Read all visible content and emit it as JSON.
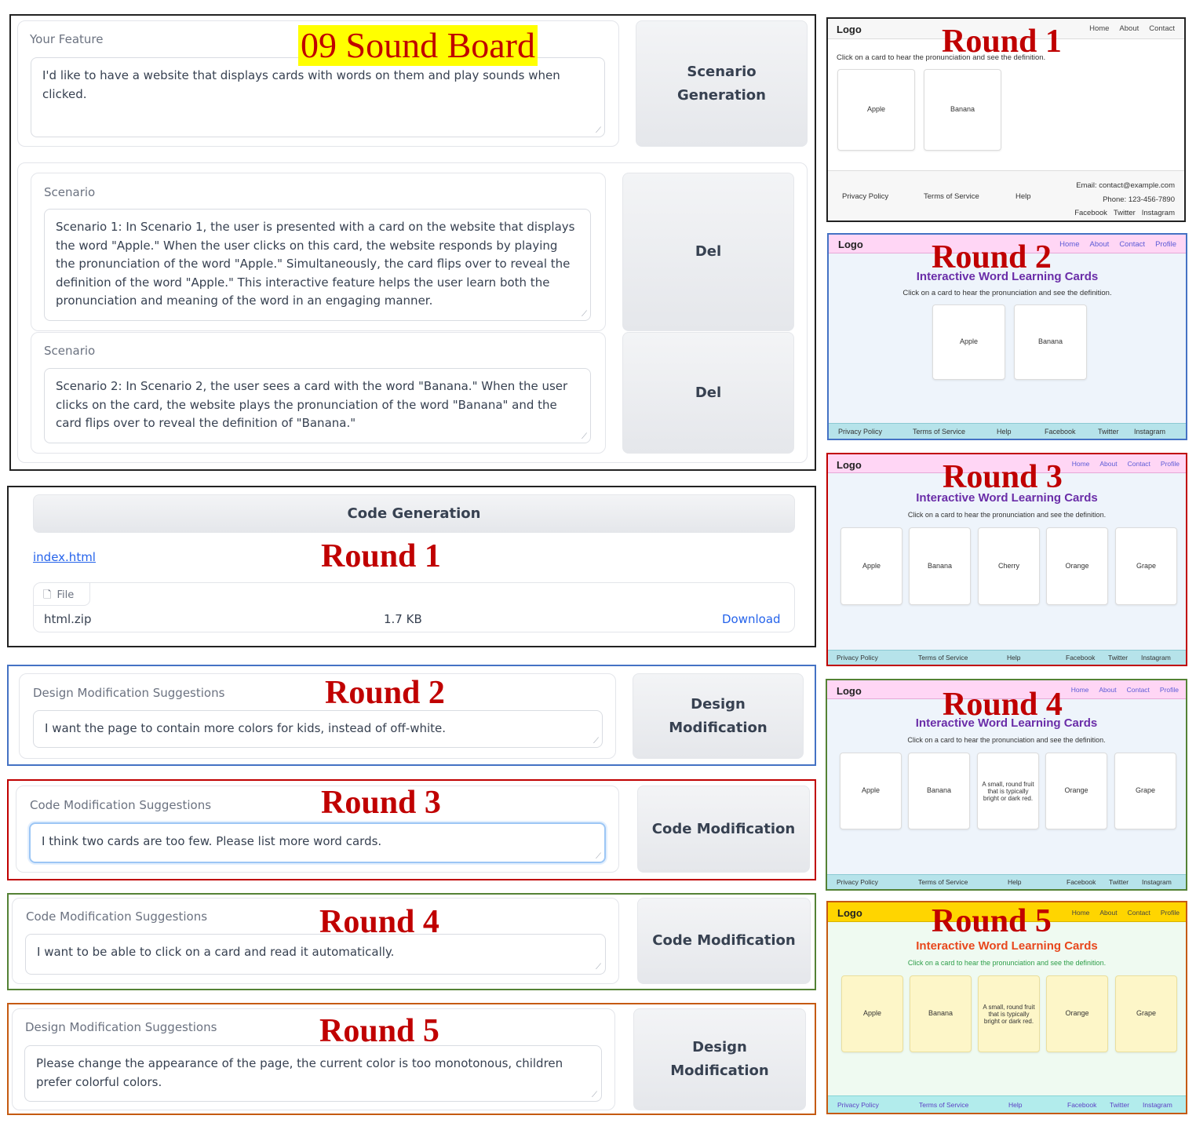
{
  "title": "09 Sound Board",
  "feature": {
    "label": "Your Feature",
    "text": "I'd like to have a website that displays cards with words on them and play sounds when clicked.",
    "button": "Scenario Generation"
  },
  "scenarios": [
    {
      "label": "Scenario",
      "text": "Scenario 1: In Scenario 1, the user is presented with a card on the website that displays the word \"Apple.\" When the user clicks on this card, the website responds by playing the pronunciation of the word \"Apple.\" Simultaneously, the card flips over to reveal the definition of the word \"Apple.\" This interactive feature helps the user learn both the pronunciation and meaning of the word in an engaging manner.",
      "button": "Del"
    },
    {
      "label": "Scenario",
      "text": "Scenario 2: In Scenario 2, the user sees a card with the word \"Banana.\" When the user clicks on the card, the website plays the pronunciation of the word \"Banana\" and the card flips over to reveal the definition of \"Banana.\"",
      "button": "Del"
    }
  ],
  "codegen": {
    "button": "Code Generation",
    "link": "index.html",
    "file_header": "File",
    "file_name": "html.zip",
    "file_size": "1.7 KB",
    "download": "Download"
  },
  "rounds": [
    {
      "label": "Round 1"
    },
    {
      "label": "Round 2",
      "field_label": "Design Modification Suggestions",
      "text": "I want the page to contain more colors for kids, instead of off-white.",
      "button": "Design Modification"
    },
    {
      "label": "Round 3",
      "field_label": "Code Modification Suggestions",
      "text": "I think two cards are too few. Please list more word cards.",
      "button": "Code Modification"
    },
    {
      "label": "Round 4",
      "field_label": "Code Modification Suggestions",
      "text": "I want to be able to click on a card and read it automatically.",
      "button": "Code Modification"
    },
    {
      "label": "Round 5",
      "field_label": "Design Modification Suggestions",
      "text": "Please change the appearance of the page, the current color is too monotonous, children prefer colorful colors.",
      "button": "Design Modification"
    }
  ],
  "previews": {
    "r1": {
      "label": "Round 1",
      "logo": "Logo",
      "nav": [
        "Home",
        "About",
        "Contact"
      ],
      "subtitle": "Click on a card to hear the pronunciation and see the definition.",
      "cards": [
        "Apple",
        "Banana"
      ],
      "footer_links": [
        "Privacy Policy",
        "Terms of Service",
        "Help"
      ],
      "email": "Email: contact@example.com",
      "phone": "Phone: 123-456-7890",
      "social": [
        "Facebook",
        "Twitter",
        "Instagram"
      ]
    },
    "r2": {
      "label": "Round 2",
      "logo": "Logo",
      "nav": [
        "Home",
        "About",
        "Contact",
        "Profile"
      ],
      "title": "Interactive Word Learning Cards",
      "subtitle": "Click on a card to hear the pronunciation and see the definition.",
      "cards": [
        "Apple",
        "Banana"
      ],
      "footer": [
        "Privacy Policy",
        "Terms of Service",
        "Help",
        "Facebook",
        "Twitter",
        "Instagram"
      ]
    },
    "r3": {
      "label": "Round 3",
      "logo": "Logo",
      "nav": [
        "Home",
        "About",
        "Contact",
        "Profile"
      ],
      "title": "Interactive Word Learning Cards",
      "subtitle": "Click on a card to hear the pronunciation and see the definition.",
      "cards": [
        "Apple",
        "Banana",
        "Cherry",
        "Orange",
        "Grape"
      ],
      "footer": [
        "Privacy Policy",
        "Terms of Service",
        "Help",
        "Facebook",
        "Twitter",
        "Instagram"
      ]
    },
    "r4": {
      "label": "Round 4",
      "logo": "Logo",
      "nav": [
        "Home",
        "About",
        "Contact",
        "Profile"
      ],
      "title": "Interactive Word Learning Cards",
      "subtitle": "Click on a card to hear the pronunciation and see the definition.",
      "cards": [
        "Apple",
        "Banana",
        "A small, round fruit that is typically bright or dark red.",
        "Orange",
        "Grape"
      ],
      "footer": [
        "Privacy Policy",
        "Terms of Service",
        "Help",
        "Facebook",
        "Twitter",
        "Instagram"
      ]
    },
    "r5": {
      "label": "Round 5",
      "logo": "Logo",
      "nav": [
        "Home",
        "About",
        "Contact",
        "Profile"
      ],
      "title": "Interactive Word Learning Cards",
      "subtitle": "Click on a card to hear the pronunciation and see the definition.",
      "cards": [
        "Apple",
        "Banana",
        "A small, round fruit that is typically bright or dark red.",
        "Orange",
        "Grape"
      ],
      "footer": [
        "Privacy Policy",
        "Terms of Service",
        "Help",
        "Facebook",
        "Twitter",
        "Instagram"
      ]
    }
  },
  "colors": {
    "round_label": "#c00000",
    "title_highlight": "#ffff00",
    "frame_round2": "#4472c4",
    "frame_round3": "#c00000",
    "frame_round4": "#548235",
    "frame_round5": "#c55a11",
    "link": "#2563eb"
  }
}
